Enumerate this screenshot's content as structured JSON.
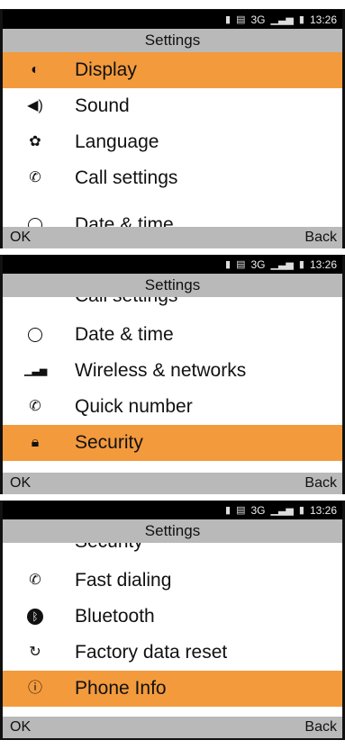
{
  "status": {
    "time": "13:26",
    "network": "3G"
  },
  "title": "Settings",
  "softkeys": {
    "ok": "OK",
    "back": "Back"
  },
  "screen1": {
    "items": [
      {
        "label": "Display",
        "icon": "brightness-icon"
      },
      {
        "label": "Sound",
        "icon": "speaker-icon"
      },
      {
        "label": "Language",
        "icon": "language-icon"
      },
      {
        "label": "Call settings",
        "icon": "phone-icon"
      },
      {
        "label": "Date & time",
        "icon": "clock-icon"
      }
    ]
  },
  "screen2": {
    "partial_top": "Call settings",
    "items": [
      {
        "label": "Date & time",
        "icon": "clock-icon"
      },
      {
        "label": "Wireless & networks",
        "icon": "signal-icon"
      },
      {
        "label": "Quick number",
        "icon": "phone-icon"
      },
      {
        "label": "Security",
        "icon": "lock-icon"
      }
    ]
  },
  "screen3": {
    "partial_top": "Security",
    "items": [
      {
        "label": "Fast dialing",
        "icon": "phone-icon"
      },
      {
        "label": "Bluetooth",
        "icon": "bluetooth-icon"
      },
      {
        "label": "Factory data reset",
        "icon": "reset-icon"
      },
      {
        "label": "Phone Info",
        "icon": "info-icon"
      }
    ]
  },
  "colors": {
    "selected": "#f39a3d",
    "bar": "#b9b9b9",
    "status": "#000000"
  }
}
